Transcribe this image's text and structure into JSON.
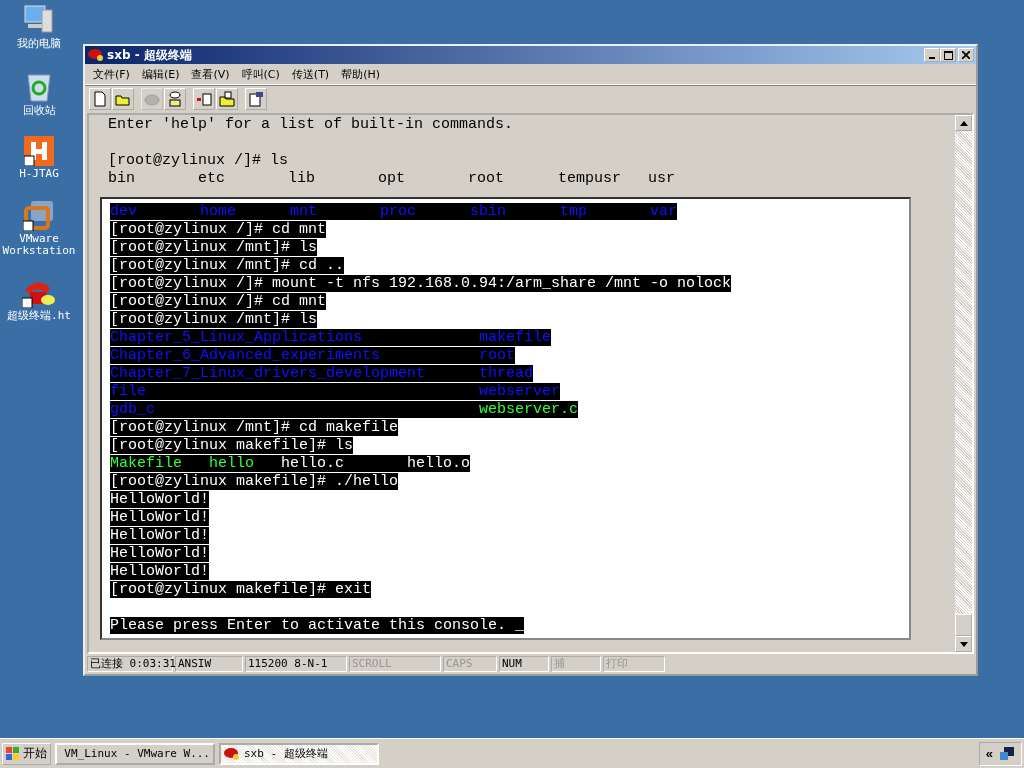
{
  "desktop_icons": [
    {
      "label": "我的电脑",
      "kind": "computer"
    },
    {
      "label": "回收站",
      "kind": "recycle"
    },
    {
      "label": "H-JTAG",
      "kind": "hjtag"
    },
    {
      "label": "VMware Workstation",
      "kind": "vmware"
    },
    {
      "label": "超级终端.ht",
      "kind": "phone"
    }
  ],
  "window": {
    "title": "sxb - 超级终端"
  },
  "menu": [
    "文件(F)",
    "编辑(E)",
    "查看(V)",
    "呼叫(C)",
    "传送(T)",
    "帮助(H)"
  ],
  "toolbar": [
    {
      "kind": "new",
      "disabled": false
    },
    {
      "kind": "open",
      "disabled": false
    },
    {
      "kind": "call",
      "disabled": true
    },
    {
      "kind": "hangup",
      "disabled": false
    },
    {
      "kind": "send",
      "disabled": false
    },
    {
      "kind": "receive",
      "disabled": false
    },
    {
      "kind": "properties",
      "disabled": false
    }
  ],
  "terminal_top": [
    {
      "segments": [
        {
          "text": "Enter 'help' for a list of built-in commands."
        }
      ]
    },
    {
      "blank_line_before": true,
      "segments": [
        {
          "text": "[root@zylinux /]# ls"
        }
      ]
    },
    {
      "segments": [
        {
          "text": "bin       etc       lib       opt       root      tempusr   usr"
        }
      ]
    }
  ],
  "terminal_panel": [
    {
      "highlight": true,
      "segments": [
        {
          "text": "dev       home      mnt       proc      sbin      tmp       var",
          "kind": "directory"
        }
      ]
    },
    {
      "highlight": true,
      "segments": [
        {
          "text": "[root@zylinux /]# cd mnt"
        }
      ]
    },
    {
      "highlight": true,
      "segments": [
        {
          "text": "[root@zylinux /mnt]# ls"
        }
      ]
    },
    {
      "highlight": true,
      "segments": [
        {
          "text": "[root@zylinux /mnt]# cd .."
        }
      ]
    },
    {
      "highlight": true,
      "segments": [
        {
          "text": "[root@zylinux /]# mount -t nfs 192.168.0.94:/arm_share /mnt -o nolock"
        }
      ]
    },
    {
      "highlight": true,
      "segments": [
        {
          "text": "[root@zylinux /]# cd mnt"
        }
      ]
    },
    {
      "highlight": true,
      "segments": [
        {
          "text": "[root@zylinux /mnt]# ls"
        }
      ]
    },
    {
      "highlight": true,
      "segments": [
        {
          "text": "Chapter_5_Linux_Applications             ",
          "kind": "directory"
        },
        {
          "text": "makefile",
          "kind": "directory"
        }
      ]
    },
    {
      "highlight": true,
      "segments": [
        {
          "text": "Chapter_6_Advanced_experiments           ",
          "kind": "directory"
        },
        {
          "text": "root",
          "kind": "directory"
        }
      ]
    },
    {
      "highlight": true,
      "segments": [
        {
          "text": "Chapter_7_Linux_drivers_development      ",
          "kind": "directory"
        },
        {
          "text": "thread",
          "kind": "directory"
        }
      ]
    },
    {
      "highlight": true,
      "segments": [
        {
          "text": "file                                     ",
          "kind": "directory"
        },
        {
          "text": "webserver",
          "kind": "directory"
        }
      ]
    },
    {
      "highlight": true,
      "segments": [
        {
          "text": "gdb_c                                    ",
          "kind": "directory"
        },
        {
          "text": "webserver.c",
          "kind": "executable"
        }
      ]
    },
    {
      "highlight": true,
      "segments": [
        {
          "text": "[root@zylinux /mnt]# cd makefile"
        }
      ]
    },
    {
      "highlight": true,
      "segments": [
        {
          "text": "[root@zylinux makefile]# ls"
        }
      ]
    },
    {
      "highlight": true,
      "segments": [
        {
          "text": "Makefile   ",
          "kind": "executable"
        },
        {
          "text": "hello",
          "kind": "executable"
        },
        {
          "text": "   hello.c       hello.o"
        }
      ]
    },
    {
      "highlight": true,
      "segments": [
        {
          "text": "[root@zylinux makefile]# ./hello"
        }
      ]
    },
    {
      "highlight": true,
      "segments": [
        {
          "text": "HelloWorld!"
        }
      ]
    },
    {
      "highlight": true,
      "segments": [
        {
          "text": "HelloWorld!"
        }
      ]
    },
    {
      "highlight": true,
      "segments": [
        {
          "text": "HelloWorld!"
        }
      ]
    },
    {
      "highlight": true,
      "segments": [
        {
          "text": "HelloWorld!"
        }
      ]
    },
    {
      "highlight": true,
      "segments": [
        {
          "text": "HelloWorld!"
        }
      ]
    },
    {
      "highlight": true,
      "segments": [
        {
          "text": "[root@zylinux makefile]# exit"
        }
      ]
    },
    {
      "highlight": false
    },
    {
      "highlight": true,
      "segments": [
        {
          "text": "Please press Enter to activate this console. _"
        }
      ]
    }
  ],
  "status_bar": [
    {
      "text": "已连接 0:03:31",
      "disabled": false
    },
    {
      "text": "ANSIW",
      "disabled": false
    },
    {
      "text": "115200 8-N-1",
      "disabled": false
    },
    {
      "text": "SCROLL",
      "disabled": true
    },
    {
      "text": "CAPS",
      "disabled": true
    },
    {
      "text": "NUM",
      "disabled": false
    },
    {
      "text": "捕",
      "disabled": true
    },
    {
      "text": "打印",
      "disabled": true
    }
  ],
  "taskbar": {
    "start": "开始",
    "tasks": [
      {
        "label": "VM_Linux - VMware W...",
        "kind": "vmware",
        "selected": false
      },
      {
        "label": "sxb - 超级终端",
        "kind": "phone",
        "selected": true
      }
    ],
    "tray": "«"
  }
}
